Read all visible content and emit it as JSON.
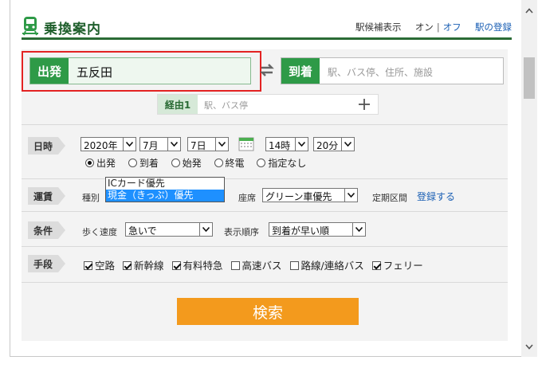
{
  "header": {
    "title": "乗換案内",
    "station_suggest_label": "駅候補表示",
    "on_label": "オン",
    "divider": "|",
    "off_label": "オフ",
    "register_station_label": "駅の登録"
  },
  "departure": {
    "label": "出発",
    "value": "五反田"
  },
  "arrival": {
    "label": "到着",
    "placeholder": "駅、バス停、住所、施設"
  },
  "via": {
    "label": "経由1",
    "placeholder": "駅、バス停"
  },
  "datetime": {
    "label": "日時",
    "year": "2020年",
    "month": "7月",
    "day": "7日",
    "hour": "14時",
    "minute": "20分",
    "radios": [
      {
        "label": "出発",
        "checked": true
      },
      {
        "label": "到着",
        "checked": false
      },
      {
        "label": "始発",
        "checked": false
      },
      {
        "label": "終電",
        "checked": false
      },
      {
        "label": "指定なし",
        "checked": false
      }
    ]
  },
  "fare": {
    "label": "運賃",
    "type_label": "種別",
    "type_options": [
      "ICカード優先",
      "現金（きっぷ）優先"
    ],
    "type_highlighted": "現金（きっぷ）優先",
    "seat_label": "座席",
    "seat_value": "グリーン車優先",
    "commuter_label": "定期区間",
    "commuter_link": "登録する"
  },
  "conditions": {
    "label": "条件",
    "walk_speed_label": "歩く速度",
    "walk_speed_value": "急いで",
    "order_label": "表示順序",
    "order_value": "到着が早い順"
  },
  "means": {
    "label": "手段",
    "options": [
      {
        "label": "空路",
        "checked": true
      },
      {
        "label": "新幹線",
        "checked": true
      },
      {
        "label": "有料特急",
        "checked": true
      },
      {
        "label": "高速バス",
        "checked": false
      },
      {
        "label": "路線/連絡バス",
        "checked": false
      },
      {
        "label": "フェリー",
        "checked": true
      }
    ]
  },
  "search_button": "検索",
  "colors": {
    "brand_green": "#2e9a47",
    "header_green": "#1f5f2c",
    "search_orange": "#f39a1d",
    "highlight_red": "#e32222",
    "link_blue": "#1a5fb4"
  }
}
